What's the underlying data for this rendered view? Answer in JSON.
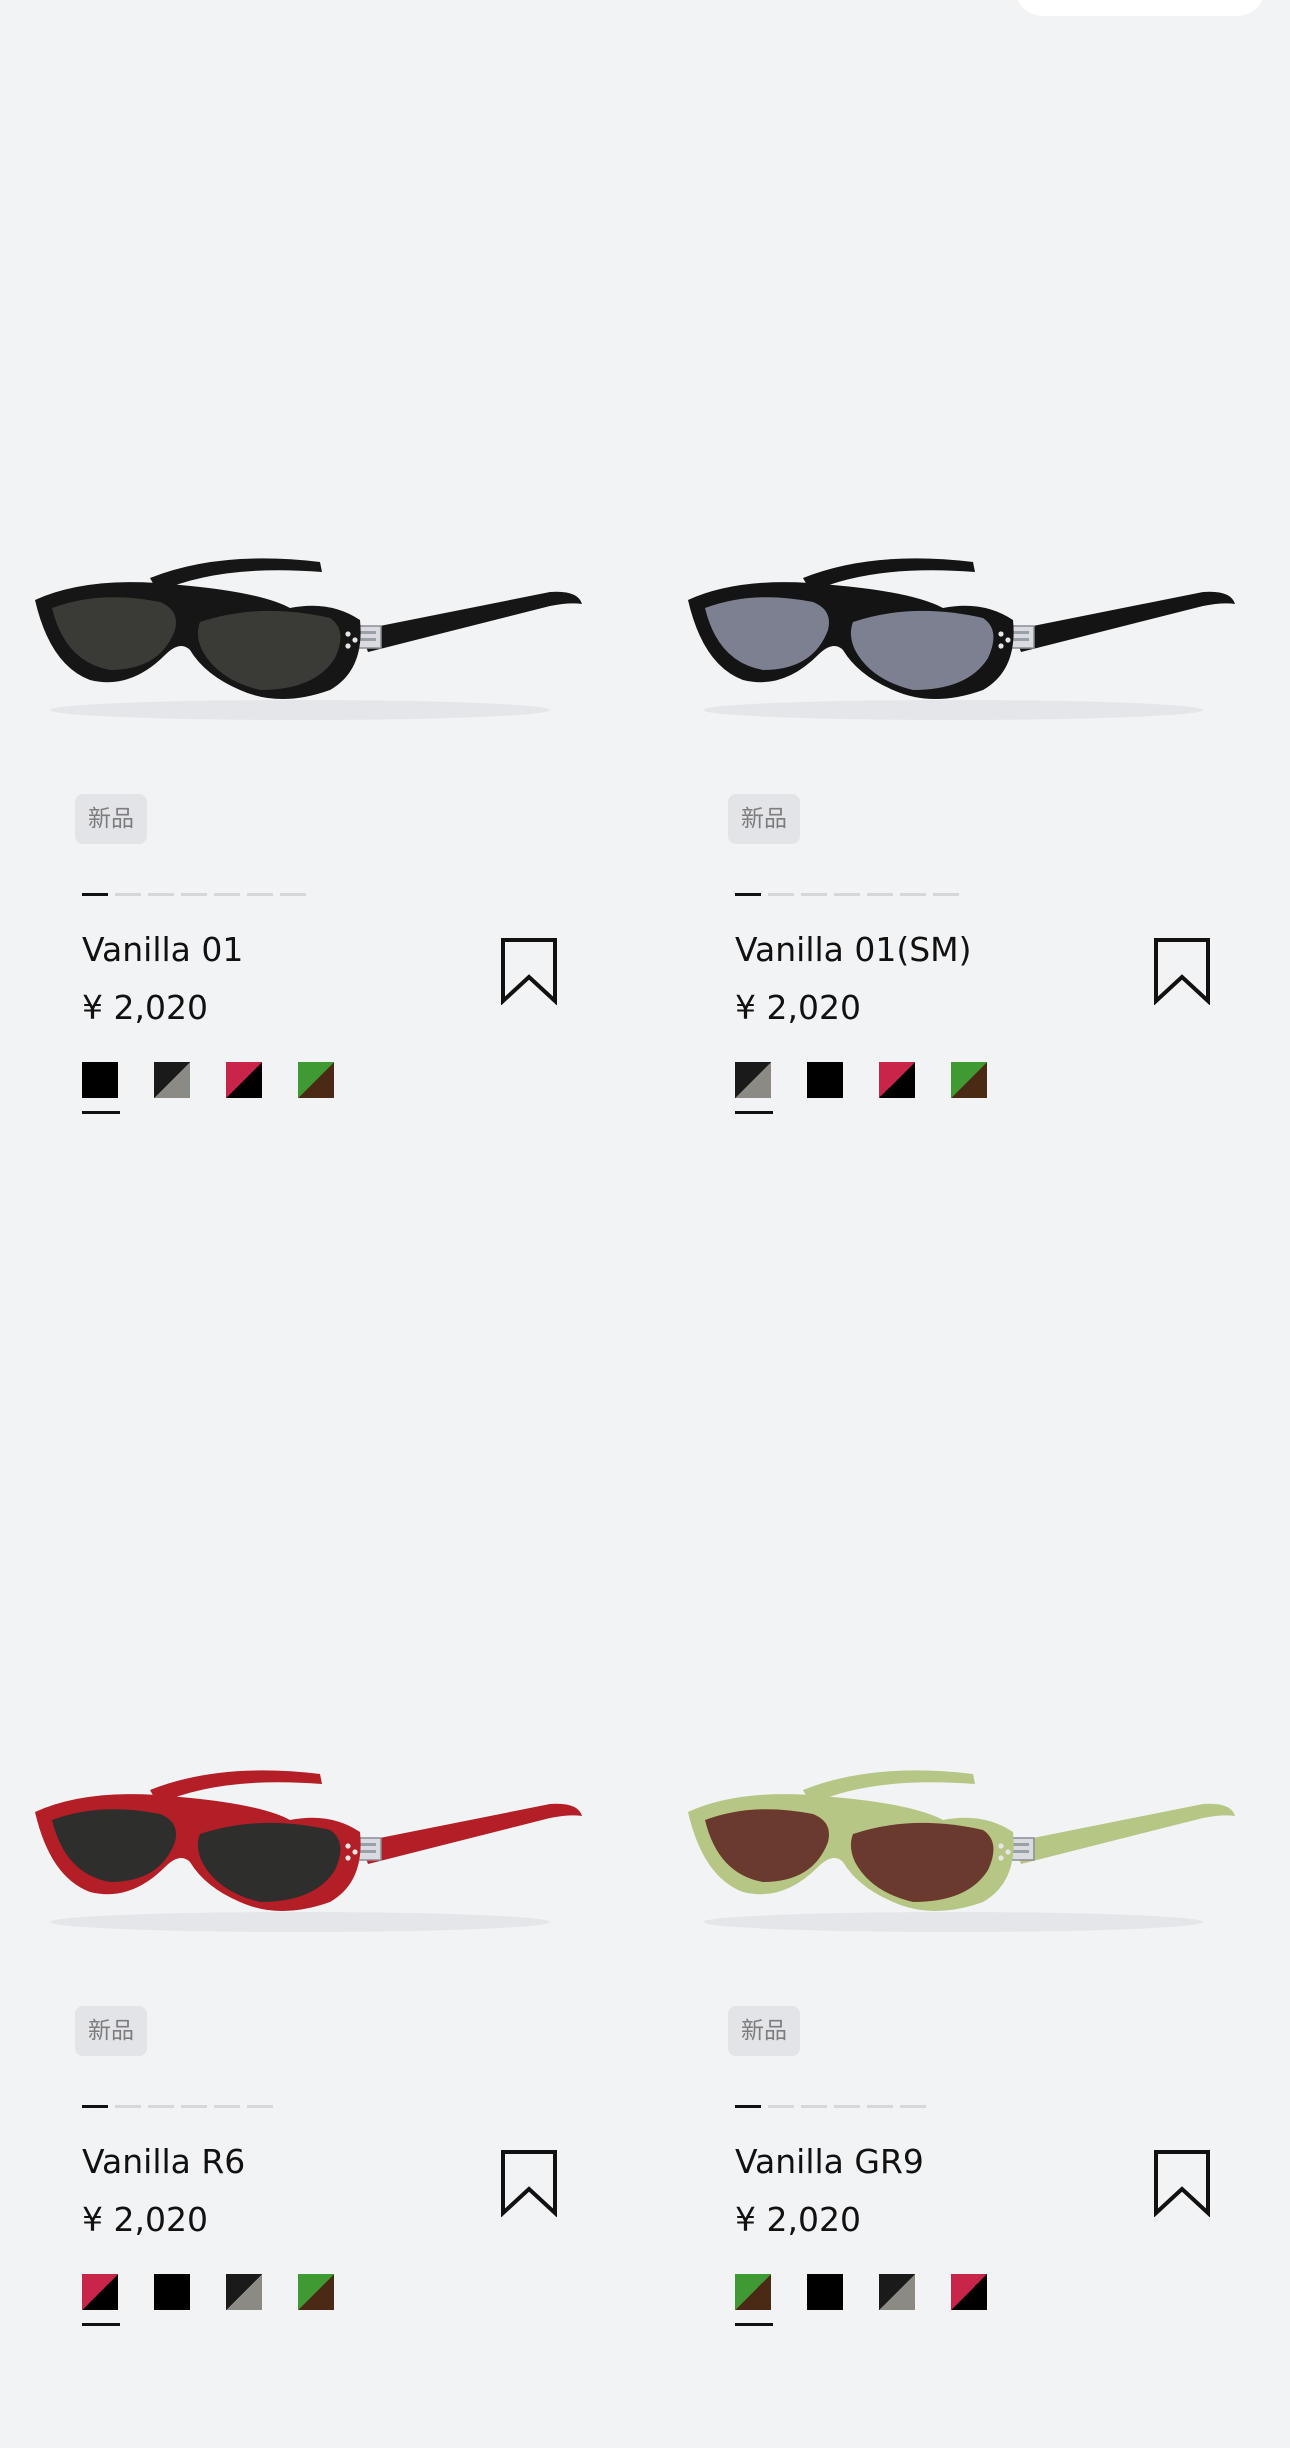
{
  "header": {
    "pill_label": ""
  },
  "products": [
    {
      "badge": "新品",
      "name": "Vanilla 01",
      "price": "¥ 2,020",
      "image_icon": "sunglasses-black-icon",
      "frame_color": "#161616",
      "lens_color": "#3a3a36",
      "gallery_total": 7,
      "gallery_active": 1,
      "swatches": [
        {
          "name": "black",
          "colors": [
            "#000000",
            "#000000"
          ]
        },
        {
          "name": "black-grey",
          "colors": [
            "#1a1a1a",
            "#8c8a84"
          ]
        },
        {
          "name": "red-black",
          "colors": [
            "#c9254a",
            "#000000"
          ]
        },
        {
          "name": "green-brown",
          "colors": [
            "#3f9a33",
            "#4a2a14"
          ]
        }
      ],
      "selected_swatch": 1
    },
    {
      "badge": "新品",
      "name": "Vanilla 01(SM)",
      "price": "¥ 2,020",
      "image_icon": "sunglasses-black-grey-lens-icon",
      "frame_color": "#141414",
      "lens_color": "#7c8090",
      "gallery_total": 7,
      "gallery_active": 1,
      "swatches": [
        {
          "name": "black-grey",
          "colors": [
            "#1a1a1a",
            "#8c8a84"
          ]
        },
        {
          "name": "black",
          "colors": [
            "#000000",
            "#000000"
          ]
        },
        {
          "name": "red-black",
          "colors": [
            "#c9254a",
            "#000000"
          ]
        },
        {
          "name": "green-brown",
          "colors": [
            "#3f9a33",
            "#4a2a14"
          ]
        }
      ],
      "selected_swatch": 1
    },
    {
      "badge": "新品",
      "name": "Vanilla R6",
      "price": "¥ 2,020",
      "image_icon": "sunglasses-red-icon",
      "frame_color": "#b41e26",
      "lens_color": "#2e2e2c",
      "gallery_total": 6,
      "gallery_active": 1,
      "swatches": [
        {
          "name": "red-black",
          "colors": [
            "#c9254a",
            "#000000"
          ]
        },
        {
          "name": "black",
          "colors": [
            "#000000",
            "#000000"
          ]
        },
        {
          "name": "black-grey",
          "colors": [
            "#1a1a1a",
            "#8c8a84"
          ]
        },
        {
          "name": "green-brown",
          "colors": [
            "#3f9a33",
            "#4a2a14"
          ]
        }
      ],
      "selected_swatch": 1
    },
    {
      "badge": "新品",
      "name": "Vanilla GR9",
      "price": "¥ 2,020",
      "image_icon": "sunglasses-green-icon",
      "frame_color": "#b6c685",
      "lens_color": "#6a3a2e",
      "gallery_total": 6,
      "gallery_active": 1,
      "swatches": [
        {
          "name": "green-brown",
          "colors": [
            "#3f9a33",
            "#4a2a14"
          ]
        },
        {
          "name": "black",
          "colors": [
            "#000000",
            "#000000"
          ]
        },
        {
          "name": "black-grey",
          "colors": [
            "#1a1a1a",
            "#8c8a84"
          ]
        },
        {
          "name": "red-black",
          "colors": [
            "#c9254a",
            "#000000"
          ]
        }
      ],
      "selected_swatch": 1
    }
  ]
}
